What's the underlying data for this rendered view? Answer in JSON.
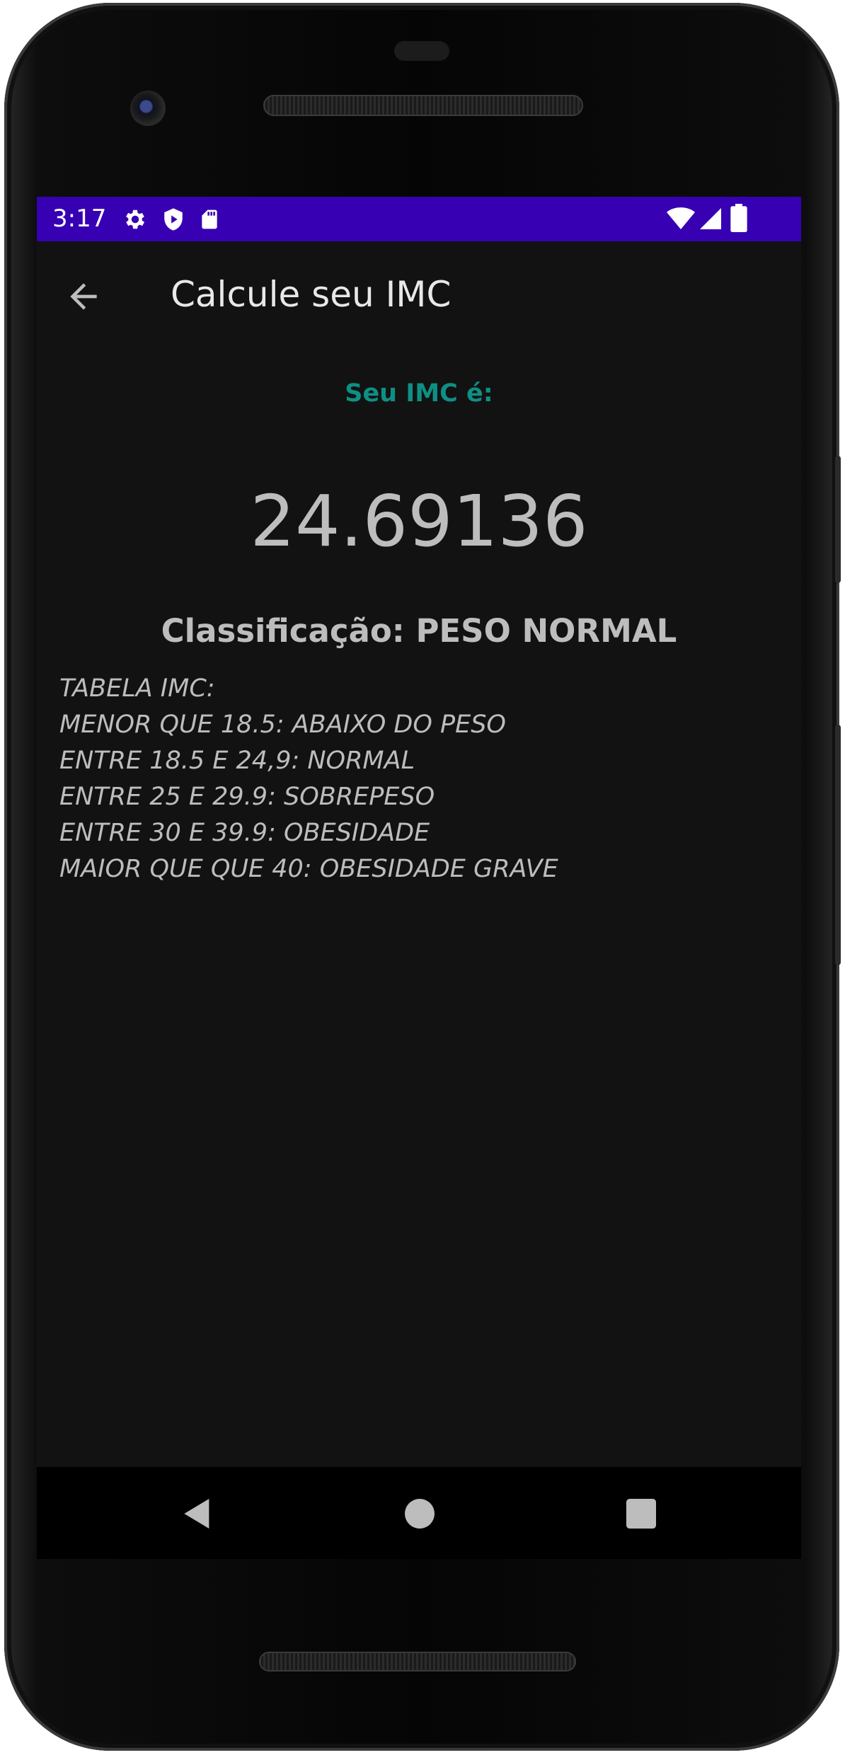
{
  "status_bar": {
    "time": "3:17",
    "left_icons": [
      "gear-icon",
      "shield-play-icon",
      "sd-card-icon"
    ],
    "right_icons": [
      "wifi-icon",
      "signal-icon",
      "battery-icon"
    ],
    "background": "#3700b3"
  },
  "app_bar": {
    "title": "Calcule seu IMC",
    "back_icon": "arrow-back-icon"
  },
  "result": {
    "label": "Seu IMC é:",
    "value": "24.69136",
    "classification": "Classificação: PESO NORMAL"
  },
  "table": {
    "title": "TABELA IMC:",
    "rows": [
      "MENOR QUE 18.5: ABAIXO DO PESO",
      "ENTRE 18.5 E 24,9: NORMAL",
      "ENTRE 25 E 29.9: SOBREPESO",
      "ENTRE 30 E 39.9: OBESIDADE",
      "MAIOR QUE QUE 40: OBESIDADE GRAVE"
    ]
  },
  "nav_bar": {
    "buttons": [
      "back-triangle-icon",
      "home-circle-icon",
      "recents-square-icon"
    ]
  },
  "colors": {
    "accent_label": "#0f8f84",
    "screen_bg": "#121212",
    "text": "#bdbdbd"
  }
}
